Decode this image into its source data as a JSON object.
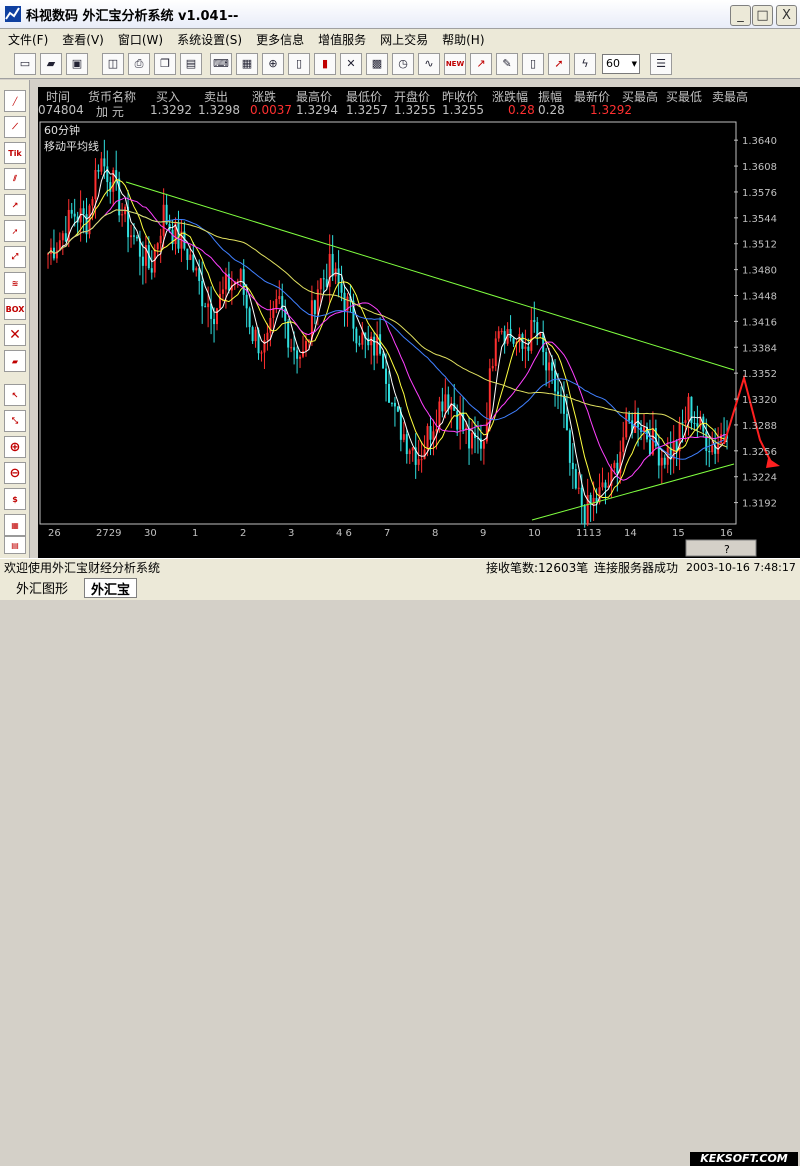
{
  "window": {
    "title": "科视数码 外汇宝分析系统 v1.041--",
    "controls": {
      "minimize": "_",
      "maximize": "□",
      "close": "X"
    }
  },
  "menu": [
    "文件(F)",
    "查看(V)",
    "窗口(W)",
    "系统设置(S)",
    "更多信息",
    "增值服务",
    "网上交易",
    "帮助(H)"
  ],
  "toolbar": {
    "buttons": [
      "new-file-icon",
      "open-folder-icon",
      "save-icon",
      "print-preview-icon",
      "print-icon",
      "copy-icon",
      "paste-icon",
      "keyboard-icon",
      "chart-icon",
      "link-icon",
      "book-icon",
      "bar-chart-icon",
      "crosshair-icon",
      "grid-icon",
      "clock-icon",
      "indicator-icon",
      "new-icon",
      "zoom-icon",
      "pencil-icon",
      "page-icon",
      "arrow-icon",
      "lightning-icon"
    ],
    "new_label": "NEW",
    "period_value": "60",
    "last_button": "list-icon"
  },
  "left_toolbar": [
    "trend-line-icon",
    "fan-line-icon",
    "tick-icon",
    "parallel-line-icon",
    "ray-icon",
    "arrow-line-icon",
    "extend-line-icon",
    "fibonacci-icon",
    "box-icon",
    "delete-icon",
    "eraser-icon",
    "cursor-icon",
    "zoom-in-icon",
    "zoom-out-icon",
    "plus-icon",
    "minus-icon",
    "price-icon",
    "calc-icon"
  ],
  "left_labels": {
    "tik": "Tik",
    "box": "BOX"
  },
  "quote": {
    "headers": [
      "时间",
      "货币名称",
      "买入",
      "卖出",
      "涨跌",
      "最高价",
      "最低价",
      "开盘价",
      "昨收价",
      "涨跌幅",
      "振幅",
      "最新价",
      "买最高",
      "买最低",
      "卖最高"
    ],
    "time": "074804",
    "currency": "加 元",
    "buy": "1.3292",
    "sell": "1.3298",
    "change": "0.0037",
    "high": "1.3294",
    "low": "1.3257",
    "open": "1.3255",
    "prev_close": "1.3255",
    "change_pct": "0.28",
    "amplitude": "0.28",
    "last": "1.3292"
  },
  "chart_data": {
    "type": "candlestick",
    "period_label": "60分钟",
    "indicator_label": "移动平均线",
    "y_ticks": [
      "1.3640",
      "1.3608",
      "1.3576",
      "1.3544",
      "1.3512",
      "1.3480",
      "1.3448",
      "1.3416",
      "1.3384",
      "1.3352",
      "1.3320",
      "1.3288",
      "1.3256",
      "1.3224",
      "1.3192"
    ],
    "ylim": [
      1.3168,
      1.366
    ],
    "x_ticks": [
      "26",
      "2729",
      "30",
      "1",
      "2",
      "3",
      "4 6",
      "7",
      "8",
      "9",
      "10",
      "1113",
      "14",
      "15",
      "16"
    ],
    "close_series": [
      1.35,
      1.352,
      1.355,
      1.354,
      1.362,
      1.359,
      1.354,
      1.351,
      1.348,
      1.355,
      1.352,
      1.35,
      1.345,
      1.343,
      1.346,
      1.347,
      1.34,
      1.338,
      1.344,
      1.339,
      1.337,
      1.346,
      1.348,
      1.345,
      1.341,
      1.338,
      1.339,
      1.33,
      1.327,
      1.325,
      1.329,
      1.333,
      1.33,
      1.326,
      1.327,
      1.342,
      1.34,
      1.338,
      1.341,
      1.335,
      1.332,
      1.321,
      1.318,
      1.32,
      1.322,
      1.328,
      1.33,
      1.327,
      1.325,
      1.326,
      1.331,
      1.328,
      1.326,
      1.329
    ]
  },
  "status": {
    "welcome": "欢迎使用外汇宝财经分析系统",
    "received": "接收笔数:12603笔",
    "connection": "连接服务器成功",
    "datetime": "2003-10-16  7:48:17"
  },
  "tabs": [
    "外汇图形",
    "外汇宝"
  ],
  "watermark": "KEKSOFT.COM"
}
